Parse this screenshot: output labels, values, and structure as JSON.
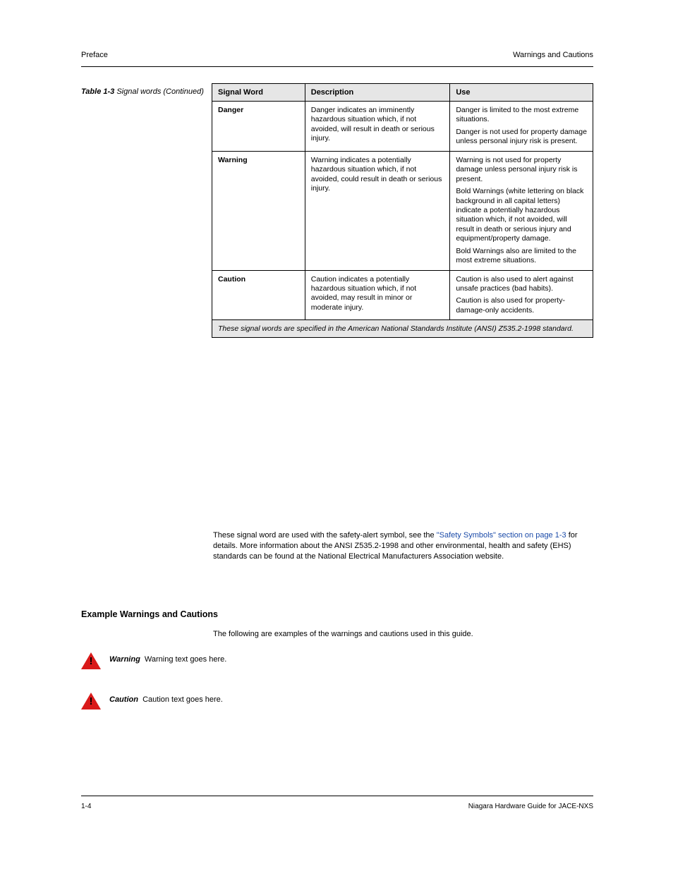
{
  "header": {
    "left": "Preface",
    "right": "Warnings and Cautions"
  },
  "footer": {
    "left": "1-4",
    "right": "Niagara Hardware Guide for JACE-NXS"
  },
  "tableTitle": "Table 1-3",
  "tableTitleRest": "Signal words (Continued)",
  "columns": {
    "c0": "Signal Word",
    "c1": "Description",
    "c2": "Use"
  },
  "rows": [
    {
      "label": "Danger",
      "desc": "Danger indicates an imminently hazardous situation which, if not avoided, will result in death or serious injury.",
      "usageLines": [
        "Danger is limited to the most extreme situations.",
        "Danger is not used for property damage unless personal injury risk is present."
      ]
    },
    {
      "label": "Warning",
      "desc": "Warning indicates a potentially hazardous situation which, if not avoided, could result in death or serious injury.",
      "usageLines": [
        "Warning is not used for property damage unless personal injury risk is present.",
        "Bold Warnings (white lettering on black background in all capital letters) indicate a potentially hazardous situation which, if not avoided, will result in death or serious injury and equipment/property damage.",
        "Bold Warnings also are limited to the most extreme situations."
      ]
    },
    {
      "label": "Caution",
      "desc": "Caution indicates a potentially hazardous situation which, if not avoided, may result in minor or moderate injury.",
      "usageLines": [
        "Caution is also used to alert against unsafe practices (bad habits).",
        "Caution is also used for property-damage-only accidents."
      ]
    }
  ],
  "tableNote": "These signal words are specified in the American National Standards Institute (ANSI) Z535.2-1998 standard.",
  "bodyPara": {
    "pre": "These signal word are used with the safety-alert symbol, see the ",
    "link": "\"Safety Symbols\" section on page 1-3",
    "post": " for details. More information about the ANSI Z535.2-1998 and other environmental, health and safety (EHS) standards can be found at the National Electrical Manufacturers Association website."
  },
  "sectionHeading": "Example Warnings and Cautions",
  "examplesIntro": "The following are examples of the warnings and cautions used in this guide.",
  "warnings": [
    {
      "label": "Warning",
      "text": "Warning text goes here."
    },
    {
      "label": "Caution",
      "text": "Caution text goes here."
    }
  ]
}
